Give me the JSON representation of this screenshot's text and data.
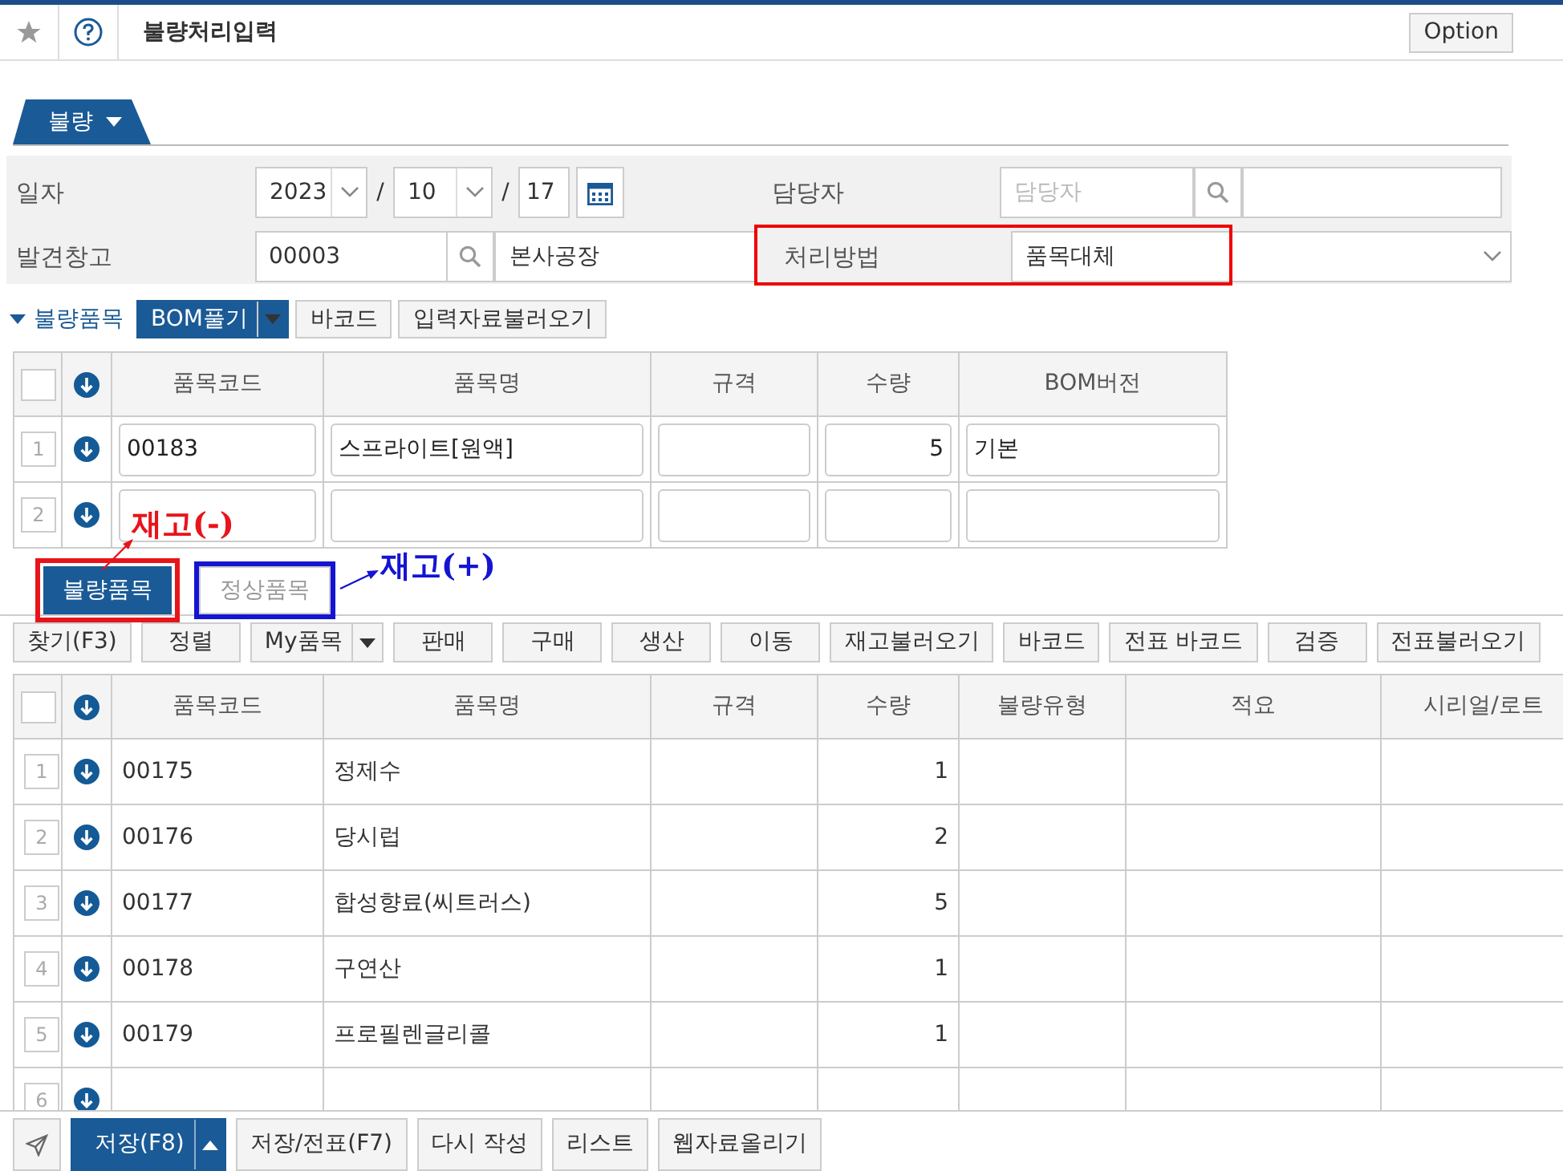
{
  "header": {
    "title": "불량처리입력",
    "option_button": "Option"
  },
  "form_tab": {
    "label": "불량"
  },
  "form": {
    "date": {
      "label": "일자",
      "year": "2023",
      "month": "10",
      "day": "17",
      "separators": [
        "/",
        "/"
      ]
    },
    "manager": {
      "label": "담당자",
      "placeholder": "담당자"
    },
    "warehouse": {
      "label": "발견창고",
      "code": "00003",
      "name": "본사공장"
    },
    "method": {
      "label": "처리방법",
      "value": "품목대체",
      "highlighted": true
    }
  },
  "section": {
    "label": "불량품목",
    "expanded": true,
    "buttons": [
      {
        "label": "BOM풀기",
        "kind": "split"
      },
      {
        "label": "바코드",
        "kind": "plain"
      },
      {
        "label": "입력자료불러오기",
        "kind": "plain"
      }
    ]
  },
  "input_table": {
    "all_checked": false,
    "columns": [
      "품목코드",
      "품목명",
      "규격",
      "수량",
      "BOM버전"
    ],
    "rows": [
      {
        "no": "1",
        "code": "00183",
        "name": "스프라이트[원액]",
        "qty": "5",
        "bom": "기본"
      },
      {
        "no": "2"
      }
    ]
  },
  "annotations": [
    {
      "text": "재고(-)",
      "color": "#e8141b"
    },
    {
      "text": "재고(+)",
      "color": "#1414d2"
    }
  ],
  "tabs": [
    {
      "label": "불량품목",
      "selected": true
    },
    {
      "label": "정상품목",
      "selected": false
    }
  ],
  "toolbar": [
    {
      "label": "찾기(F3)",
      "kind": "plain"
    },
    {
      "label": "정렬",
      "kind": "plain"
    },
    {
      "label": "My품목",
      "kind": "split"
    },
    {
      "label": "판매",
      "kind": "plain"
    },
    {
      "label": "구매",
      "kind": "plain"
    },
    {
      "label": "생산",
      "kind": "plain"
    },
    {
      "label": "이동",
      "kind": "plain"
    },
    {
      "label": "재고불러오기",
      "kind": "plain"
    },
    {
      "label": "바코드",
      "kind": "plain"
    },
    {
      "label": "전표 바코드",
      "kind": "plain"
    },
    {
      "label": "검증",
      "kind": "plain"
    },
    {
      "label": "전표불러오기",
      "kind": "plain"
    }
  ],
  "items_table": {
    "all_checked": false,
    "columns": [
      "품목코드",
      "품목명",
      "규격",
      "수량",
      "불량유형",
      "적요",
      "시리얼/로트"
    ],
    "rows": [
      {
        "no": "1",
        "code": "00175",
        "name": "정제수",
        "qty": "1"
      },
      {
        "no": "2",
        "code": "00176",
        "name": "당시럽",
        "qty": "2"
      },
      {
        "no": "3",
        "code": "00177",
        "name": "합성향료(씨트러스)",
        "qty": "5"
      },
      {
        "no": "4",
        "code": "00178",
        "name": "구연산",
        "qty": "1"
      },
      {
        "no": "5",
        "code": "00179",
        "name": "프로필렌글리콜",
        "qty": "1"
      },
      {
        "no": "6"
      }
    ]
  },
  "footer": [
    {
      "kind": "icon"
    },
    {
      "label": "저장(F8)",
      "kind": "primary-split"
    },
    {
      "label": "저장/전표(F7)",
      "kind": "plain"
    },
    {
      "label": "다시 작성",
      "kind": "plain"
    },
    {
      "label": "리스트",
      "kind": "plain"
    },
    {
      "label": "웹자료올리기",
      "kind": "plain"
    }
  ]
}
